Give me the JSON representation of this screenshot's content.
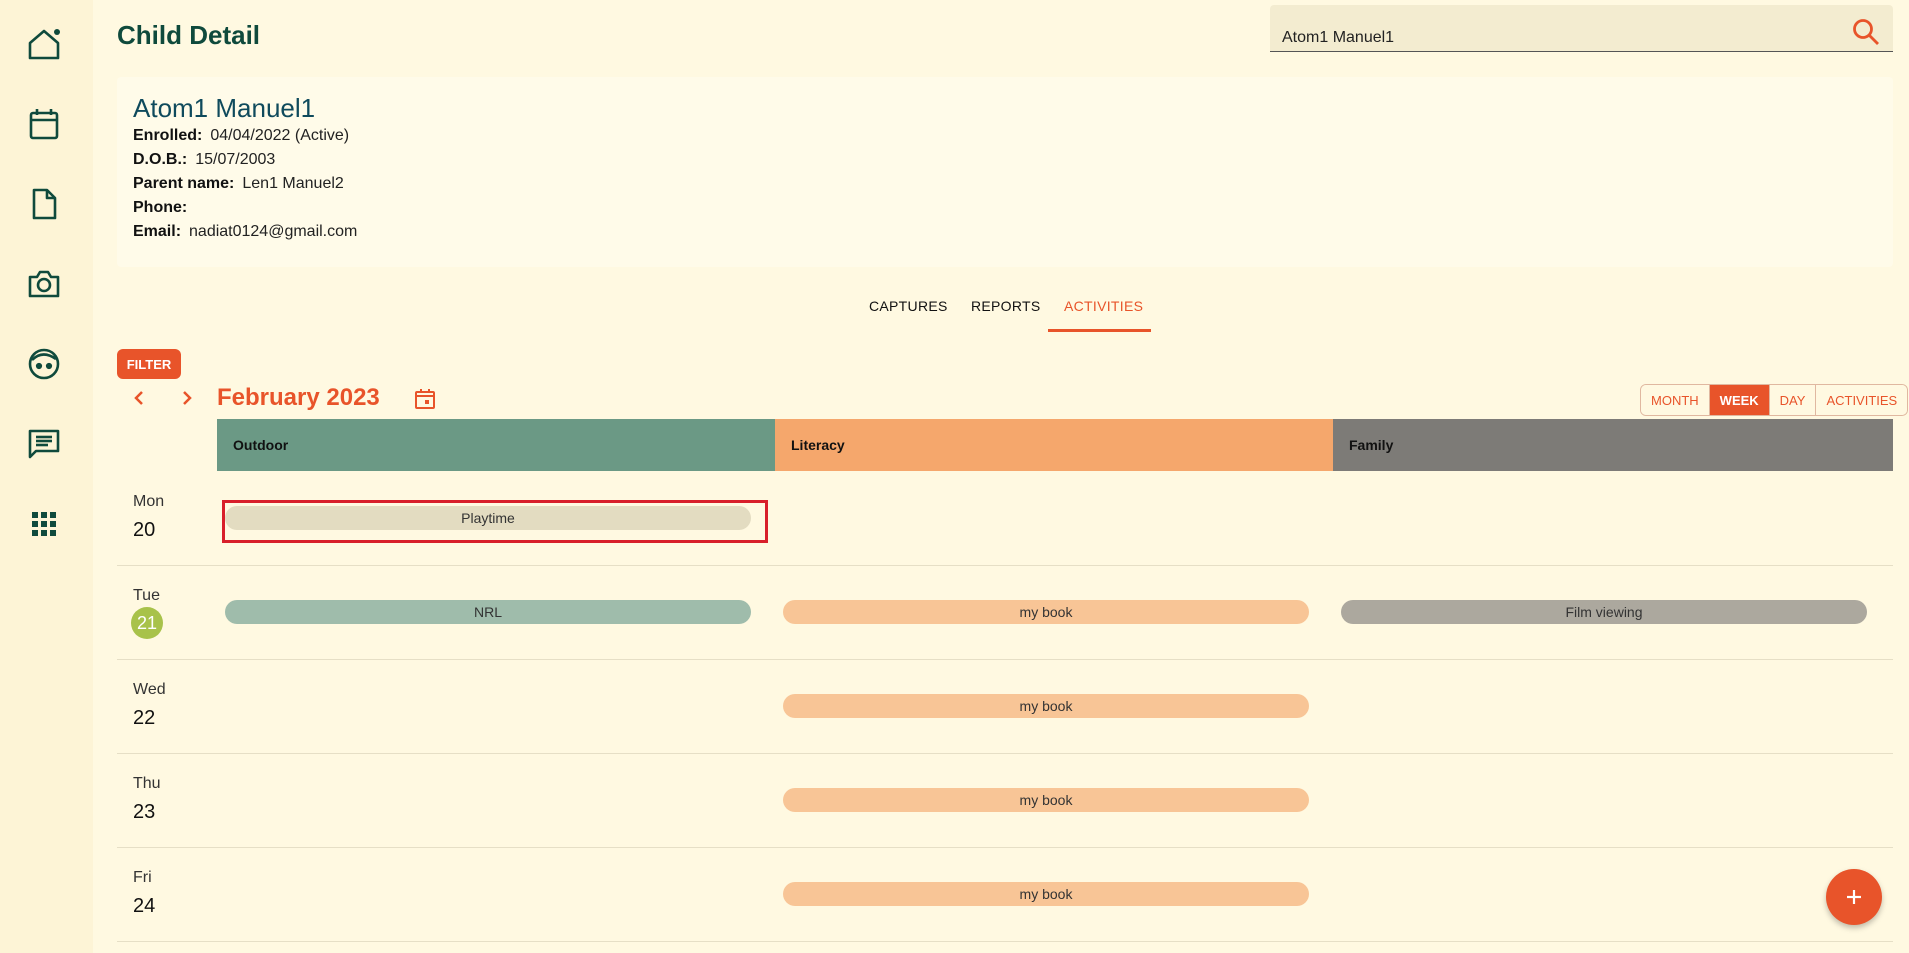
{
  "sidebar": {
    "items": [
      {
        "icon": "home-icon"
      },
      {
        "icon": "calendar-icon"
      },
      {
        "icon": "document-icon"
      },
      {
        "icon": "camera-icon"
      },
      {
        "icon": "child-face-icon"
      },
      {
        "icon": "chat-icon"
      },
      {
        "icon": "apps-grid-icon"
      }
    ]
  },
  "header": {
    "title": "Child Detail",
    "search_value": "Atom1 Manuel1"
  },
  "profile": {
    "name": "Atom1 Manuel1",
    "enrolled_label": "Enrolled:",
    "enrolled_value": "04/04/2022 (Active)",
    "dob_label": "D.O.B.:",
    "dob_value": "15/07/2003",
    "parent_label": "Parent name:",
    "parent_value": "Len1 Manuel2",
    "phone_label": "Phone:",
    "phone_value": "",
    "email_label": "Email:",
    "email_value": "nadiat0124@gmail.com"
  },
  "tabs": [
    {
      "label": "CAPTURES",
      "active": false
    },
    {
      "label": "REPORTS",
      "active": false
    },
    {
      "label": "ACTIVITIES",
      "active": true
    }
  ],
  "calendar": {
    "filter_label": "FILTER",
    "month_title": "February 2023",
    "views": [
      {
        "label": "MONTH",
        "active": false
      },
      {
        "label": "WEEK",
        "active": true
      },
      {
        "label": "DAY",
        "active": false
      },
      {
        "label": "ACTIVITIES",
        "active": false
      }
    ],
    "columns": [
      {
        "label": "Outdoor",
        "color": "#6b9985",
        "event_color": "#9fbcab"
      },
      {
        "label": "Literacy",
        "color": "#f5a76c",
        "event_color": "#f8c596"
      },
      {
        "label": "Family",
        "color": "#7d7b77",
        "event_color": "#aca89e"
      }
    ],
    "days": [
      {
        "dow": "Mon",
        "num": "20",
        "today": false,
        "events": [
          "Playtime",
          "",
          ""
        ]
      },
      {
        "dow": "Tue",
        "num": "21",
        "today": true,
        "events": [
          "NRL",
          "my book",
          "Film viewing"
        ]
      },
      {
        "dow": "Wed",
        "num": "22",
        "today": false,
        "events": [
          "",
          "my book",
          ""
        ]
      },
      {
        "dow": "Thu",
        "num": "23",
        "today": false,
        "events": [
          "",
          "my book",
          ""
        ]
      },
      {
        "dow": "Fri",
        "num": "24",
        "today": false,
        "events": [
          "",
          "my book",
          ""
        ]
      }
    ],
    "highlighted_event_color": "#e3dcc1",
    "today_color": "#a8c24a"
  },
  "fab": {
    "icon": "plus-icon"
  }
}
